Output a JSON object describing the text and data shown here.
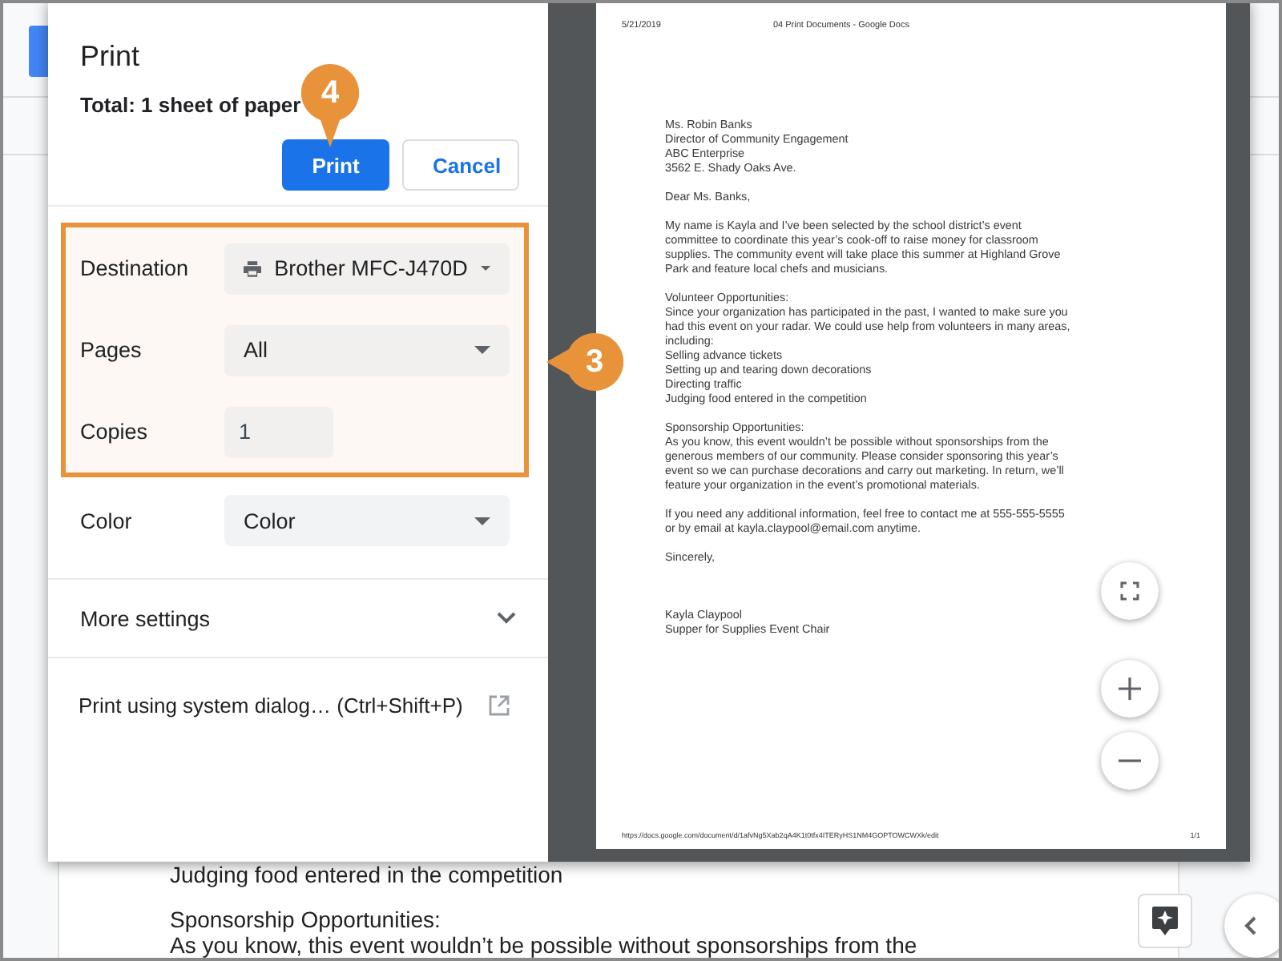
{
  "background_doc": {
    "lines": [
      "Judging food entered in the competition",
      "Sponsorship Opportunities:",
      "As you know, this event wouldn’t be possible without sponsorships from the"
    ]
  },
  "dialog": {
    "title": "Print",
    "total": "Total: 1 sheet of paper",
    "buttons": [
      {
        "label": "Print",
        "kind": "primary"
      },
      {
        "label": "Cancel",
        "kind": "secondary"
      }
    ],
    "callout": {
      "number": "4"
    },
    "highlight": {
      "callout": {
        "number": "3"
      },
      "settings": [
        {
          "label": "Destination",
          "kind": "printer-select",
          "value": "Brother MFC-J470D"
        },
        {
          "label": "Pages",
          "kind": "select",
          "value": "All"
        },
        {
          "label": "Copies",
          "kind": "number",
          "value": "1"
        }
      ]
    },
    "settings": [
      {
        "label": "Color",
        "kind": "select",
        "value": "Color"
      }
    ],
    "more_settings": {
      "label": "More settings",
      "expanded": false
    },
    "system_dialog": {
      "label": "Print using system dialog… (Ctrl+Shift+P)"
    }
  },
  "preview": {
    "header_date": "5/21/2019",
    "header_title": "04 Print Documents - Google Docs",
    "paragraphs": [
      [
        "Ms. Robin Banks",
        "Director of Community Engagement",
        "ABC Enterprise",
        "3562 E. Shady Oaks Ave."
      ],
      [
        "Dear Ms. Banks,"
      ],
      [
        "My name is Kayla and I’ve been selected by the school district’s event",
        "committee to coordinate this year’s cook-off to raise money for classroom",
        "supplies. The community event will take place this summer at Highland Grove",
        "Park and feature local chefs and musicians."
      ],
      [
        "Volunteer Opportunities:",
        "Since your organization has participated in the past, I wanted to make sure you",
        "had this event on your radar. We could use help from volunteers in many areas,",
        "including:",
        "Selling advance tickets",
        "Setting up and tearing down decorations",
        "Directing traffic",
        "Judging food entered in the competition"
      ],
      [
        "Sponsorship Opportunities:",
        "As you know, this event wouldn’t be possible without sponsorships from the",
        "generous members of our community. Please consider sponsoring this year’s",
        "event so we can purchase decorations and carry out marketing. In return, we’ll",
        "feature your organization in the event’s promotional materials."
      ],
      [
        "If you need any additional information, feel free to contact me at 555-555-5555",
        "or by email at kayla.claypool@email.com anytime."
      ],
      [
        "Sincerely,"
      ],
      [
        "Kayla Claypool",
        "Supper for Supplies Event Chair"
      ]
    ],
    "footer_url": "https://docs.google.com/document/d/1afvNg5Xab2qA4K1t0tfx4ITERyHS1NM4GOPTOWCWXk/edit",
    "page_number": "1/1"
  }
}
